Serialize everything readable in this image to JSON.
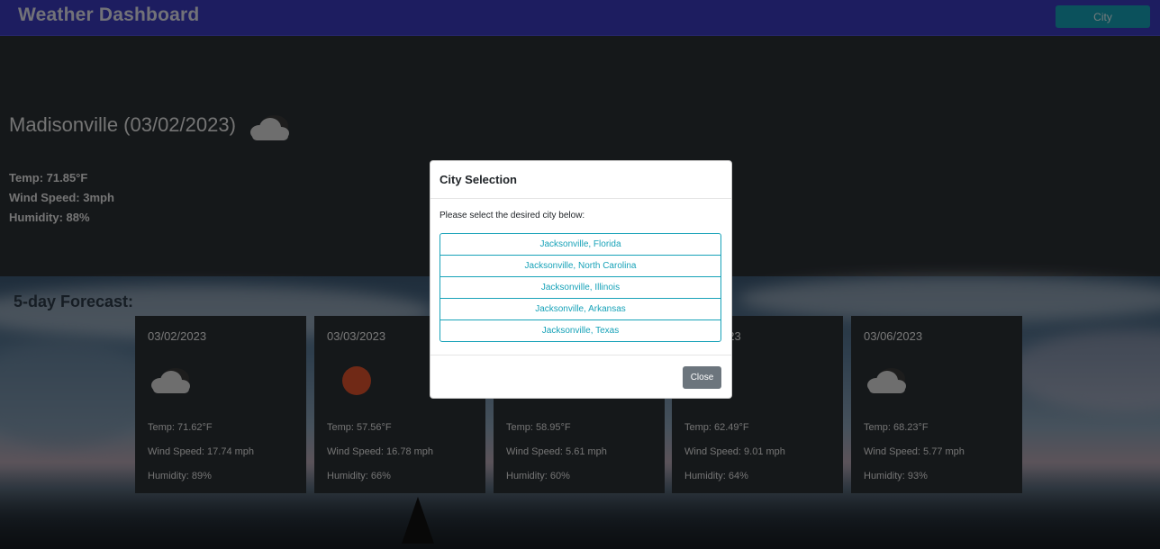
{
  "navbar": {
    "title": "Weather Dashboard",
    "city_button": "City"
  },
  "current": {
    "title": "Madisonville (03/02/2023)",
    "icon": "cloud-icon",
    "temp": "Temp: 71.85°F",
    "wind": "Wind Speed: 3mph",
    "humidity": "Humidity: 88%"
  },
  "forecast": {
    "heading": "5-day Forecast:",
    "cards": [
      {
        "date": "03/02/2023",
        "icon": "cloud-icon",
        "temp": "Temp: 71.62°F",
        "wind": "Wind Speed: 17.74 mph",
        "humidity": "Humidity: 89%"
      },
      {
        "date": "03/03/2023",
        "icon": "sun-icon",
        "temp": "Temp: 57.56°F",
        "wind": "Wind Speed: 16.78 mph",
        "humidity": "Humidity: 66%"
      },
      {
        "date": "",
        "icon": "",
        "temp": "Temp: 58.95°F",
        "wind": "Wind Speed: 5.61 mph",
        "humidity": "Humidity: 60%"
      },
      {
        "date": "023",
        "icon": "",
        "temp": "Temp: 62.49°F",
        "wind": "Wind Speed: 9.01 mph",
        "humidity": "Humidity: 64%"
      },
      {
        "date": "03/06/2023",
        "icon": "cloud-icon",
        "temp": "Temp: 68.23°F",
        "wind": "Wind Speed: 5.77 mph",
        "humidity": "Humidity: 93%"
      }
    ]
  },
  "modal": {
    "title": "City Selection",
    "prompt": "Please select the desired city below:",
    "options": [
      "Jacksonville, Florida",
      "Jacksonville, North Carolina",
      "Jacksonville, Illinois",
      "Jacksonville, Arkansas",
      "Jacksonville, Texas"
    ],
    "close_label": "Close"
  },
  "colors": {
    "navbar": "#3b3ac0",
    "accent": "#17a2b8",
    "card_bg": "#2b3035",
    "close_button": "#6c757d",
    "sun": "#e0522c"
  }
}
